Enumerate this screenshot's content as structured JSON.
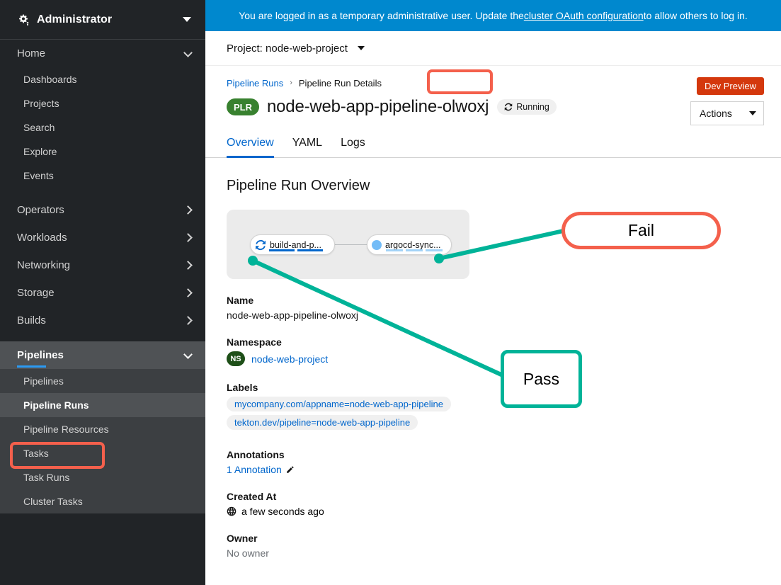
{
  "sidebar": {
    "masthead": {
      "title": "Administrator",
      "icon": "gear-icon",
      "caret": "chevron-down-icon"
    },
    "groups": [
      {
        "label": "Home",
        "expanded": true,
        "items": [
          {
            "label": "Dashboards"
          },
          {
            "label": "Projects"
          },
          {
            "label": "Search"
          },
          {
            "label": "Explore"
          },
          {
            "label": "Events"
          }
        ]
      },
      {
        "label": "Operators",
        "expanded": false,
        "items": []
      },
      {
        "label": "Workloads",
        "expanded": false,
        "items": []
      },
      {
        "label": "Networking",
        "expanded": false,
        "items": []
      },
      {
        "label": "Storage",
        "expanded": false,
        "items": []
      },
      {
        "label": "Builds",
        "expanded": false,
        "items": []
      },
      {
        "label": "Pipelines",
        "expanded": true,
        "active": true,
        "items": [
          {
            "label": "Pipelines"
          },
          {
            "label": "Pipeline Runs",
            "selected": true
          },
          {
            "label": "Pipeline Resources"
          },
          {
            "label": "Tasks"
          },
          {
            "label": "Task Runs"
          },
          {
            "label": "Cluster Tasks"
          }
        ]
      }
    ]
  },
  "banner": {
    "text_before": "You are logged in as a temporary administrative user. Update the ",
    "link_text": "cluster OAuth configuration",
    "text_after": " to allow others to log in.",
    "bg": "#0088ce"
  },
  "project_bar": {
    "label": "Project: node-web-project",
    "caret": "chevron-down-icon"
  },
  "breadcrumb": {
    "link": "Pipeline Runs",
    "separator": "›",
    "current": "Pipeline Run Details"
  },
  "header": {
    "resource_badge": "PLR",
    "title": "node-web-app-pipeline-olwoxj",
    "status": {
      "label": "Running",
      "icon": "sync-icon"
    },
    "dev_preview": "Dev Preview",
    "actions": {
      "label": "Actions",
      "caret": "chevron-down-icon"
    }
  },
  "tabs": [
    {
      "label": "Overview",
      "active": true
    },
    {
      "label": "YAML",
      "active": false
    },
    {
      "label": "Logs",
      "active": false
    }
  ],
  "overview": {
    "section_title": "Pipeline Run Overview",
    "graph": {
      "nodes": [
        {
          "label": "build-and-p...",
          "icon": "sync-icon",
          "status": "running"
        },
        {
          "label": "argocd-sync...",
          "icon": "circle-icon",
          "status": "pending"
        }
      ]
    },
    "fields": [
      {
        "key": "Name",
        "value": "node-web-app-pipeline-olwoxj"
      },
      {
        "key": "Namespace",
        "badge": "NS",
        "value": "node-web-project"
      },
      {
        "key": "Labels",
        "chips": [
          "mycompany.com/appname=node-web-app-pipeline",
          "tekton.dev/pipeline=node-web-app-pipeline"
        ]
      },
      {
        "key": "Annotations",
        "value": "1 Annotation",
        "icon": "pencil-icon"
      },
      {
        "key": "Created At",
        "value": "a few seconds ago",
        "icon": "globe-icon"
      },
      {
        "key": "Owner",
        "value": "No owner"
      }
    ]
  },
  "annotations": {
    "fail_callout": "Fail",
    "pass_callout": "Pass",
    "fail_color": "#f4604c",
    "pass_color": "#00b398"
  }
}
